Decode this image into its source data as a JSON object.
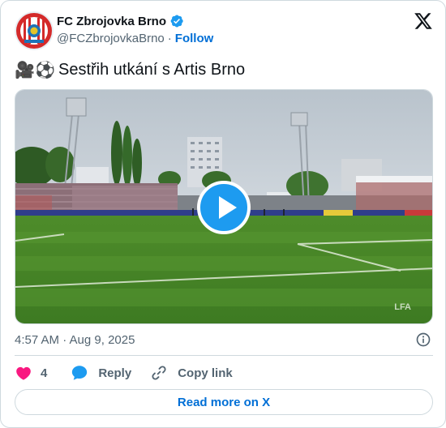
{
  "author": {
    "name": "FC Zbrojovka Brno",
    "handle": "@FCZbrojovkaBrno",
    "separator": "·",
    "follow_label": "Follow",
    "verified_color": "#1d9bf0"
  },
  "tweet": {
    "emojis": [
      "🎥",
      "⚽"
    ],
    "text": "Sestřih utkání s Artis Brno",
    "timestamp": "4:57 AM · Aug 9, 2025"
  },
  "media": {
    "type": "video",
    "watermark": "LFA",
    "play_color": "#1d9bf0"
  },
  "actions": {
    "like_count": "4",
    "reply_label": "Reply",
    "copy_label": "Copy link",
    "like_color": "#f91880",
    "reply_color": "#1d9bf0"
  },
  "footer": {
    "read_more_label": "Read more on X"
  },
  "icons": [
    "club-crest-icon",
    "verified-badge-icon",
    "x-logo-icon",
    "movie-camera-icon",
    "soccer-ball-icon",
    "play-icon",
    "info-icon",
    "heart-icon",
    "reply-bubble-icon",
    "link-icon"
  ]
}
